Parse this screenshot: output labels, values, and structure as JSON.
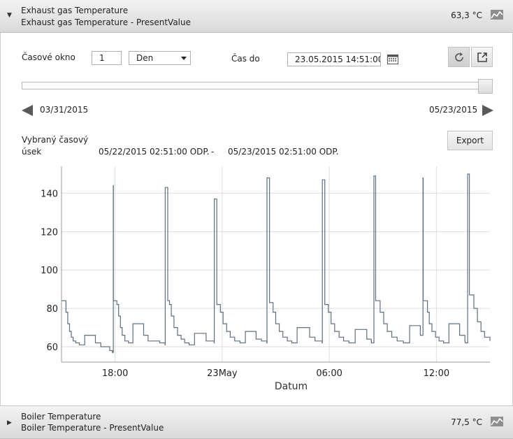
{
  "top_panel": {
    "title": "Exhaust gas Temperature",
    "subtitle": "Exhaust gas Temperature - PresentValue",
    "value": "63,3 °C",
    "expanded_icon": "caret-down-icon",
    "trend_icon": "trend-icon"
  },
  "controls": {
    "time_window_label": "Časové okno",
    "time_window_value": "1",
    "time_unit": "Den",
    "time_to_label": "Čas do",
    "time_to_value": "23.05.2015 14:51:00",
    "calendar_icon": "calendar-icon",
    "refresh_icon": "refresh-icon",
    "popout_icon": "popout-icon"
  },
  "range": {
    "start": "03/31/2015",
    "end": "05/23/2015"
  },
  "selection": {
    "label_line1": "Vybraný časový",
    "label_line2": "úsek",
    "from": "05/22/2015 02:51:00 ODP.",
    "separator": "-",
    "to": "05/23/2015 02:51:00 ODP.",
    "export_label": "Export"
  },
  "chart_data": {
    "type": "line",
    "xlabel": "Datum",
    "ylabel": "",
    "x_ticks": [
      "18:00",
      "23May",
      "06:00",
      "12:00"
    ],
    "x_tick_hours": [
      18,
      24,
      30,
      36
    ],
    "xlim_hours": [
      15,
      39
    ],
    "y_ticks": [
      60,
      80,
      100,
      120,
      140
    ],
    "ylim": [
      52,
      154
    ],
    "grid": true,
    "line_color": "#5f6f82",
    "series": [
      {
        "x_hours": [
          15.0,
          15.1,
          15.25,
          15.35,
          15.45,
          15.55,
          15.65,
          15.8,
          16.0,
          16.3,
          16.6,
          16.9,
          17.2,
          17.5,
          17.7,
          17.85,
          17.9,
          17.91,
          18.05,
          18.1,
          18.2,
          18.3,
          18.4,
          18.55,
          18.75,
          19.0,
          19.3,
          19.6,
          19.85,
          20.2,
          20.5,
          20.8,
          20.81,
          20.95,
          21.05,
          21.15,
          21.3,
          21.5,
          21.7,
          21.9,
          22.15,
          22.45,
          22.8,
          23.1,
          23.55,
          23.56,
          23.7,
          23.8,
          23.9,
          24.05,
          24.25,
          24.45,
          24.7,
          25.0,
          25.3,
          25.6,
          25.9,
          26.2,
          26.5,
          26.51,
          26.65,
          26.75,
          26.85,
          27.0,
          27.2,
          27.4,
          27.65,
          27.9,
          28.2,
          28.55,
          28.9,
          29.2,
          29.6,
          29.61,
          29.75,
          29.85,
          29.95,
          30.1,
          30.3,
          30.55,
          30.8,
          31.1,
          31.45,
          31.8,
          32.1,
          32.35,
          32.36,
          32.5,
          32.6,
          32.7,
          32.85,
          33.05,
          33.25,
          33.5,
          33.8,
          34.15,
          34.5,
          34.95,
          35.1,
          35.25,
          35.26,
          35.4,
          35.5,
          35.6,
          35.75,
          35.95,
          36.15,
          36.4,
          36.7,
          37.0,
          37.3,
          37.6,
          37.61,
          37.75,
          37.85,
          37.95,
          38.1,
          38.3,
          38.5,
          38.7,
          39.0
        ],
        "values": [
          84,
          84,
          78,
          72,
          68,
          65,
          63,
          62,
          61,
          66,
          66,
          62,
          60,
          60,
          58,
          57,
          144,
          84,
          84,
          82,
          76,
          70,
          66,
          63,
          62,
          72,
          72,
          66,
          63,
          63,
          62,
          61,
          143,
          84,
          82,
          76,
          70,
          66,
          64,
          62,
          61,
          67,
          67,
          63,
          62,
          137,
          82,
          82,
          78,
          72,
          68,
          65,
          63,
          62,
          68,
          68,
          64,
          63,
          62,
          148,
          83,
          83,
          78,
          72,
          68,
          65,
          63,
          62,
          70,
          70,
          65,
          63,
          62,
          147,
          82,
          82,
          78,
          72,
          68,
          65,
          63,
          62,
          69,
          69,
          64,
          63,
          62,
          149,
          84,
          84,
          78,
          72,
          68,
          65,
          63,
          62,
          71,
          71,
          66,
          148,
          84,
          84,
          78,
          72,
          68,
          65,
          63,
          62,
          72,
          72,
          66,
          63,
          62,
          150,
          87,
          87,
          80,
          73,
          68,
          65,
          63
        ]
      }
    ]
  },
  "bottom_panel": {
    "title": "Boiler Temperature",
    "subtitle": "Boiler Temperature - PresentValue",
    "value": "77,5 °C",
    "collapsed_icon": "caret-right-icon",
    "trend_icon": "trend-icon"
  }
}
